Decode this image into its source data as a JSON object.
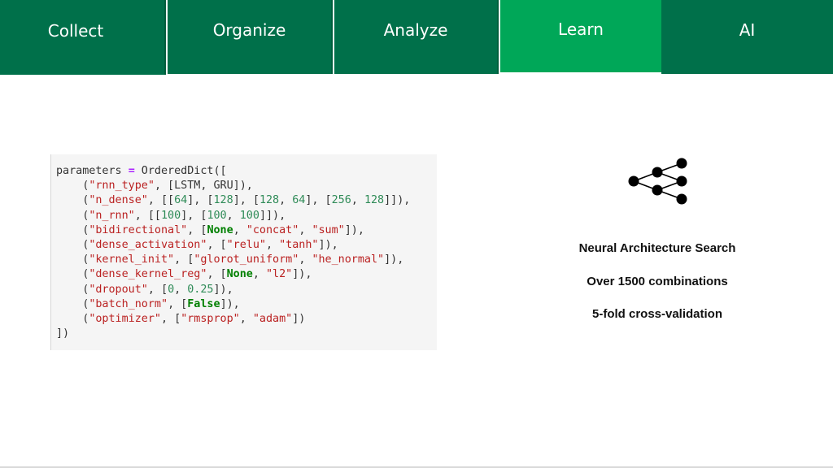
{
  "tabs": [
    {
      "label": "Collect",
      "active": false
    },
    {
      "label": "Organize",
      "active": false
    },
    {
      "label": "Analyze",
      "active": false
    },
    {
      "label": "Learn",
      "active": true
    },
    {
      "label": "AI",
      "active": false
    }
  ],
  "colors": {
    "tab_bg": "#00704a",
    "tab_active_bg": "#00a758",
    "code_bg": "#f5f5f5",
    "keyword": "#008000",
    "string": "#ba2121",
    "number": "#2e8b57"
  },
  "code": {
    "lines": [
      "parameters = OrderedDict([",
      "    (\"rnn_type\", [LSTM, GRU]),",
      "    (\"n_dense\", [[64], [128], [128, 64], [256, 128]]),",
      "    (\"n_rnn\", [[100], [100, 100]]),",
      "    (\"bidirectional\", [None, \"concat\", \"sum\"]),",
      "    (\"dense_activation\", [\"relu\", \"tanh\"]),",
      "    (\"kernel_init\", [\"glorot_uniform\", \"he_normal\"]),",
      "    (\"dense_kernel_reg\", [None, \"l2\"]),",
      "    (\"dropout\", [0, 0.25]),",
      "    (\"batch_norm\", [False]),",
      "    (\"optimizer\", [\"rmsprop\", \"adam\"])",
      "])"
    ]
  },
  "diagram": {
    "icon": "neural-network-tree-icon"
  },
  "info": {
    "line1": "Neural Architecture Search",
    "line2": "Over 1500 combinations",
    "line3": "5-fold cross-validation"
  }
}
